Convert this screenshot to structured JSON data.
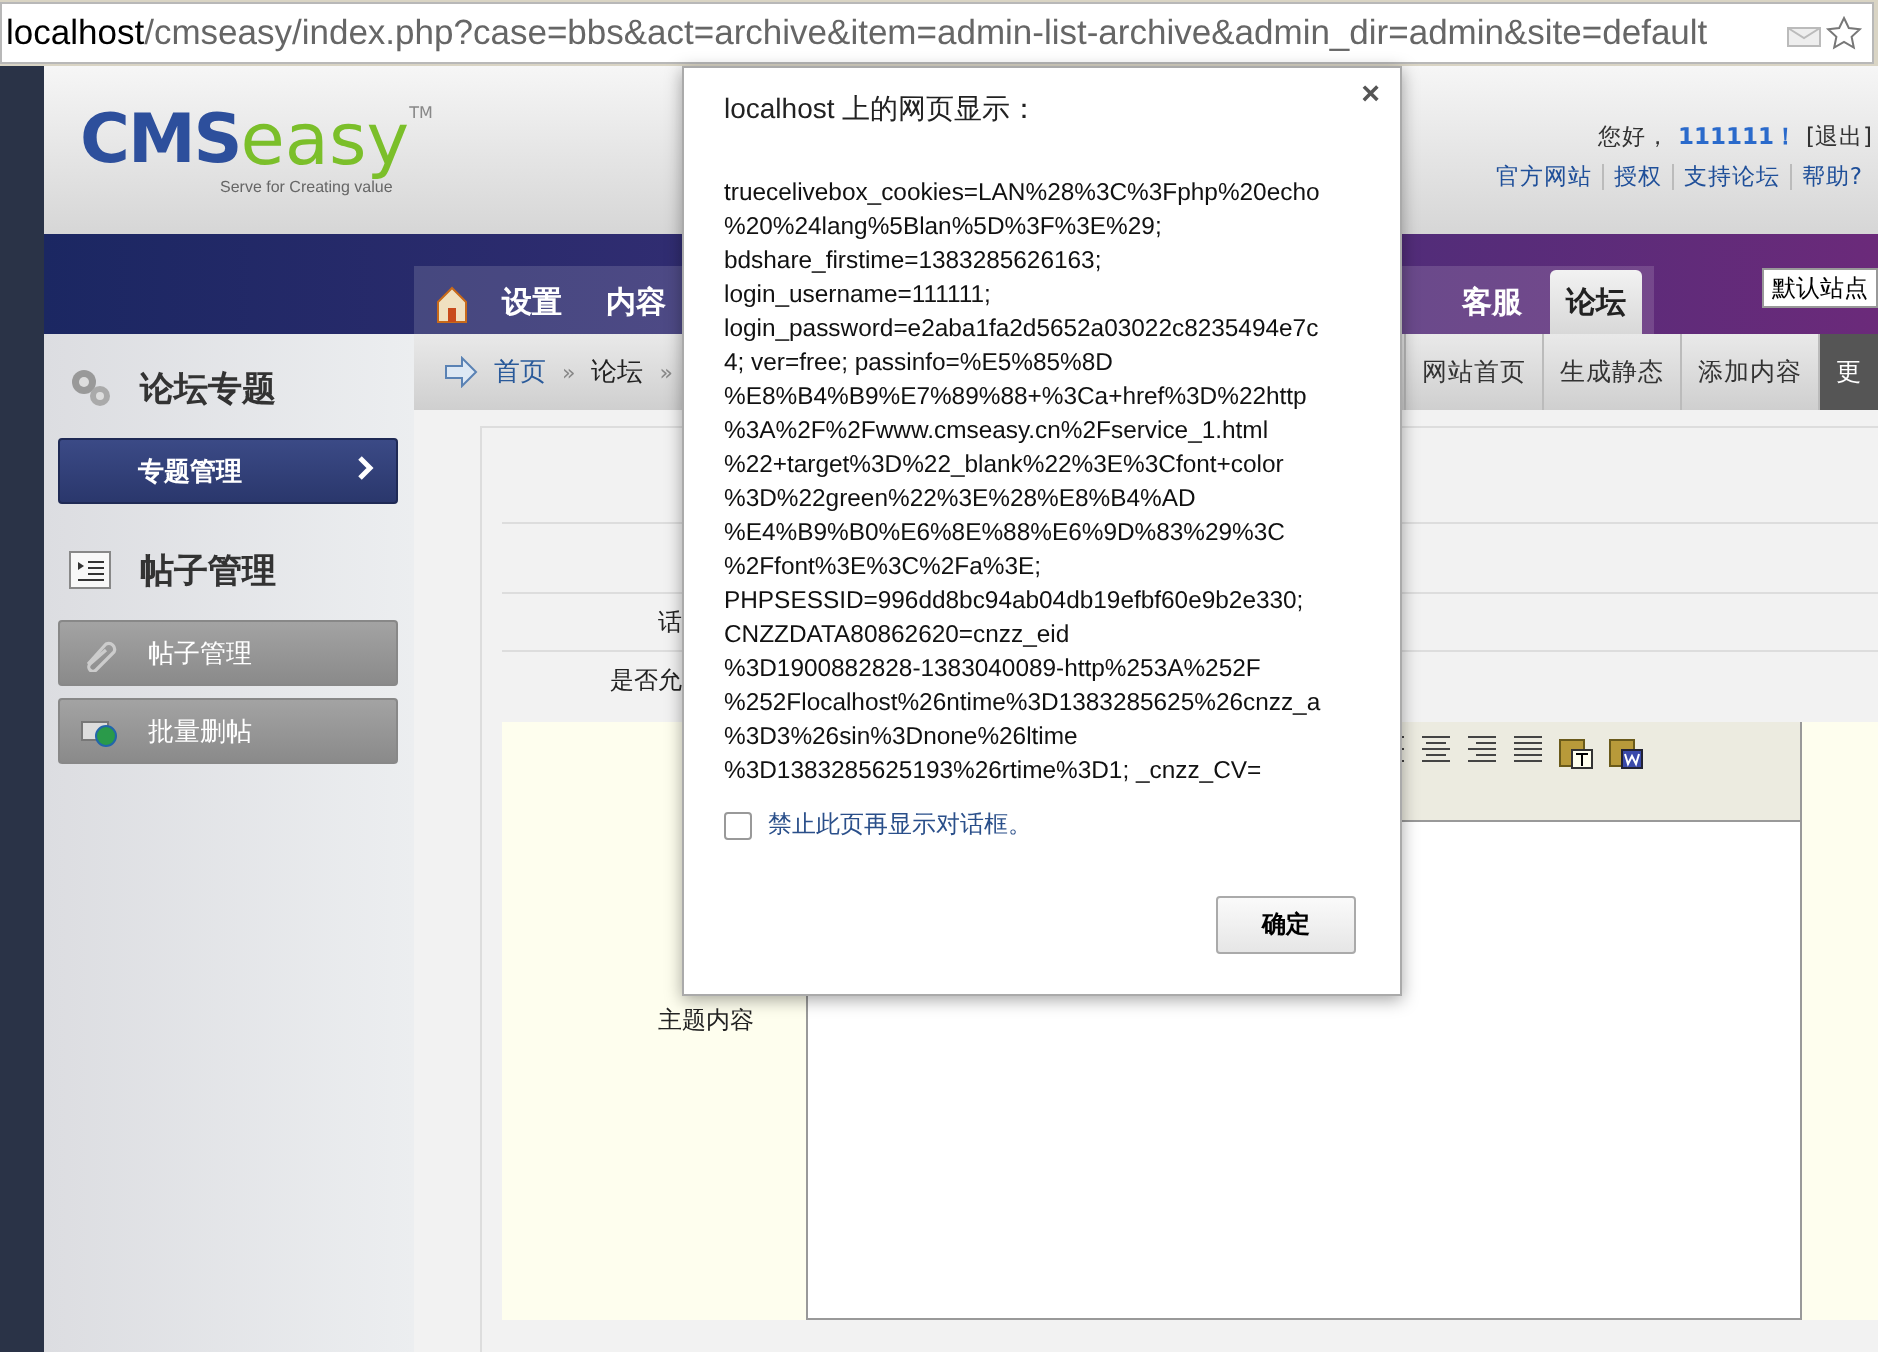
{
  "address_bar": {
    "host": "localhost",
    "path": "/cmseasy/index.php?case=bbs&act=archive&item=admin-list-archive&admin_dir=admin&site=default"
  },
  "header": {
    "logo": {
      "main": "CMS",
      "accent": "easy",
      "tm": "TM",
      "tagline": "Serve for Creating value"
    },
    "greeting": "您好，",
    "username": "111111！",
    "logout": "[退出]",
    "links": [
      "官方网站",
      "授权",
      "支持论坛",
      "帮助?"
    ]
  },
  "nav_tabs": [
    {
      "label": "设置",
      "selected": false
    },
    {
      "label": "内容",
      "selected": false
    },
    {
      "label": "客服",
      "selected": false
    },
    {
      "label": "论坛",
      "selected": true
    }
  ],
  "site_select": {
    "value": "默认站点"
  },
  "sidebar": [
    {
      "title": "论坛专题",
      "items": [
        {
          "label": "专题管理",
          "selected": true
        }
      ]
    },
    {
      "title": "帖子管理",
      "items": [
        {
          "label": "帖子管理",
          "selected": false
        },
        {
          "label": "批量删帖",
          "selected": false
        }
      ]
    }
  ],
  "breadcrumb": [
    "首页",
    "»",
    "论坛",
    "»"
  ],
  "actions": [
    {
      "label": "网站首页",
      "selected": false
    },
    {
      "label": "生成静态",
      "selected": false
    },
    {
      "label": "添加内容",
      "selected": false
    },
    {
      "label": "更",
      "selected": true
    }
  ],
  "form_rows": [
    {
      "label": ""
    },
    {
      "label": "话"
    },
    {
      "label": "是否允"
    }
  ],
  "editor": {
    "label": "主题内容"
  },
  "dialog": {
    "title": "localhost 上的网页显示：",
    "close": "×",
    "message": "truecelivebox_cookies=LAN%28%3C%3Fphp%20echo\n%20%24lang%5Blan%5D%3F%3E%29;\nbdshare_firstime=1383285626163;\nlogin_username=111111;\nlogin_password=e2aba1fa2d5652a03022c8235494e7c\n4; ver=free; passinfo=%E5%85%8D\n%E8%B4%B9%E7%89%88+%3Ca+href%3D%22http\n%3A%2F%2Fwww.cmseasy.cn%2Fservice_1.html\n%22+target%3D%22_blank%22%3E%3Cfont+color\n%3D%22green%22%3E%28%E8%B4%AD\n%E4%B9%B0%E6%8E%88%E6%9D%83%29%3C\n%2Ffont%3E%3C%2Fa%3E;\nPHPSESSID=996dd8bc94ab04db19efbf60e9b2e330;\nCNZZDATA80862620=cnzz_eid\n%3D1900882828-1383040089-http%253A%252F\n%252Flocalhost%26ntime%3D1383285625%26cnzz_a\n%3D3%26sin%3Dnone%26ltime\n%3D1383285625193%26rtime%3D1; _cnzz_CV=",
    "checkbox": {
      "label": "禁止此页再显示对话框。",
      "checked": false
    },
    "button": "确定"
  }
}
